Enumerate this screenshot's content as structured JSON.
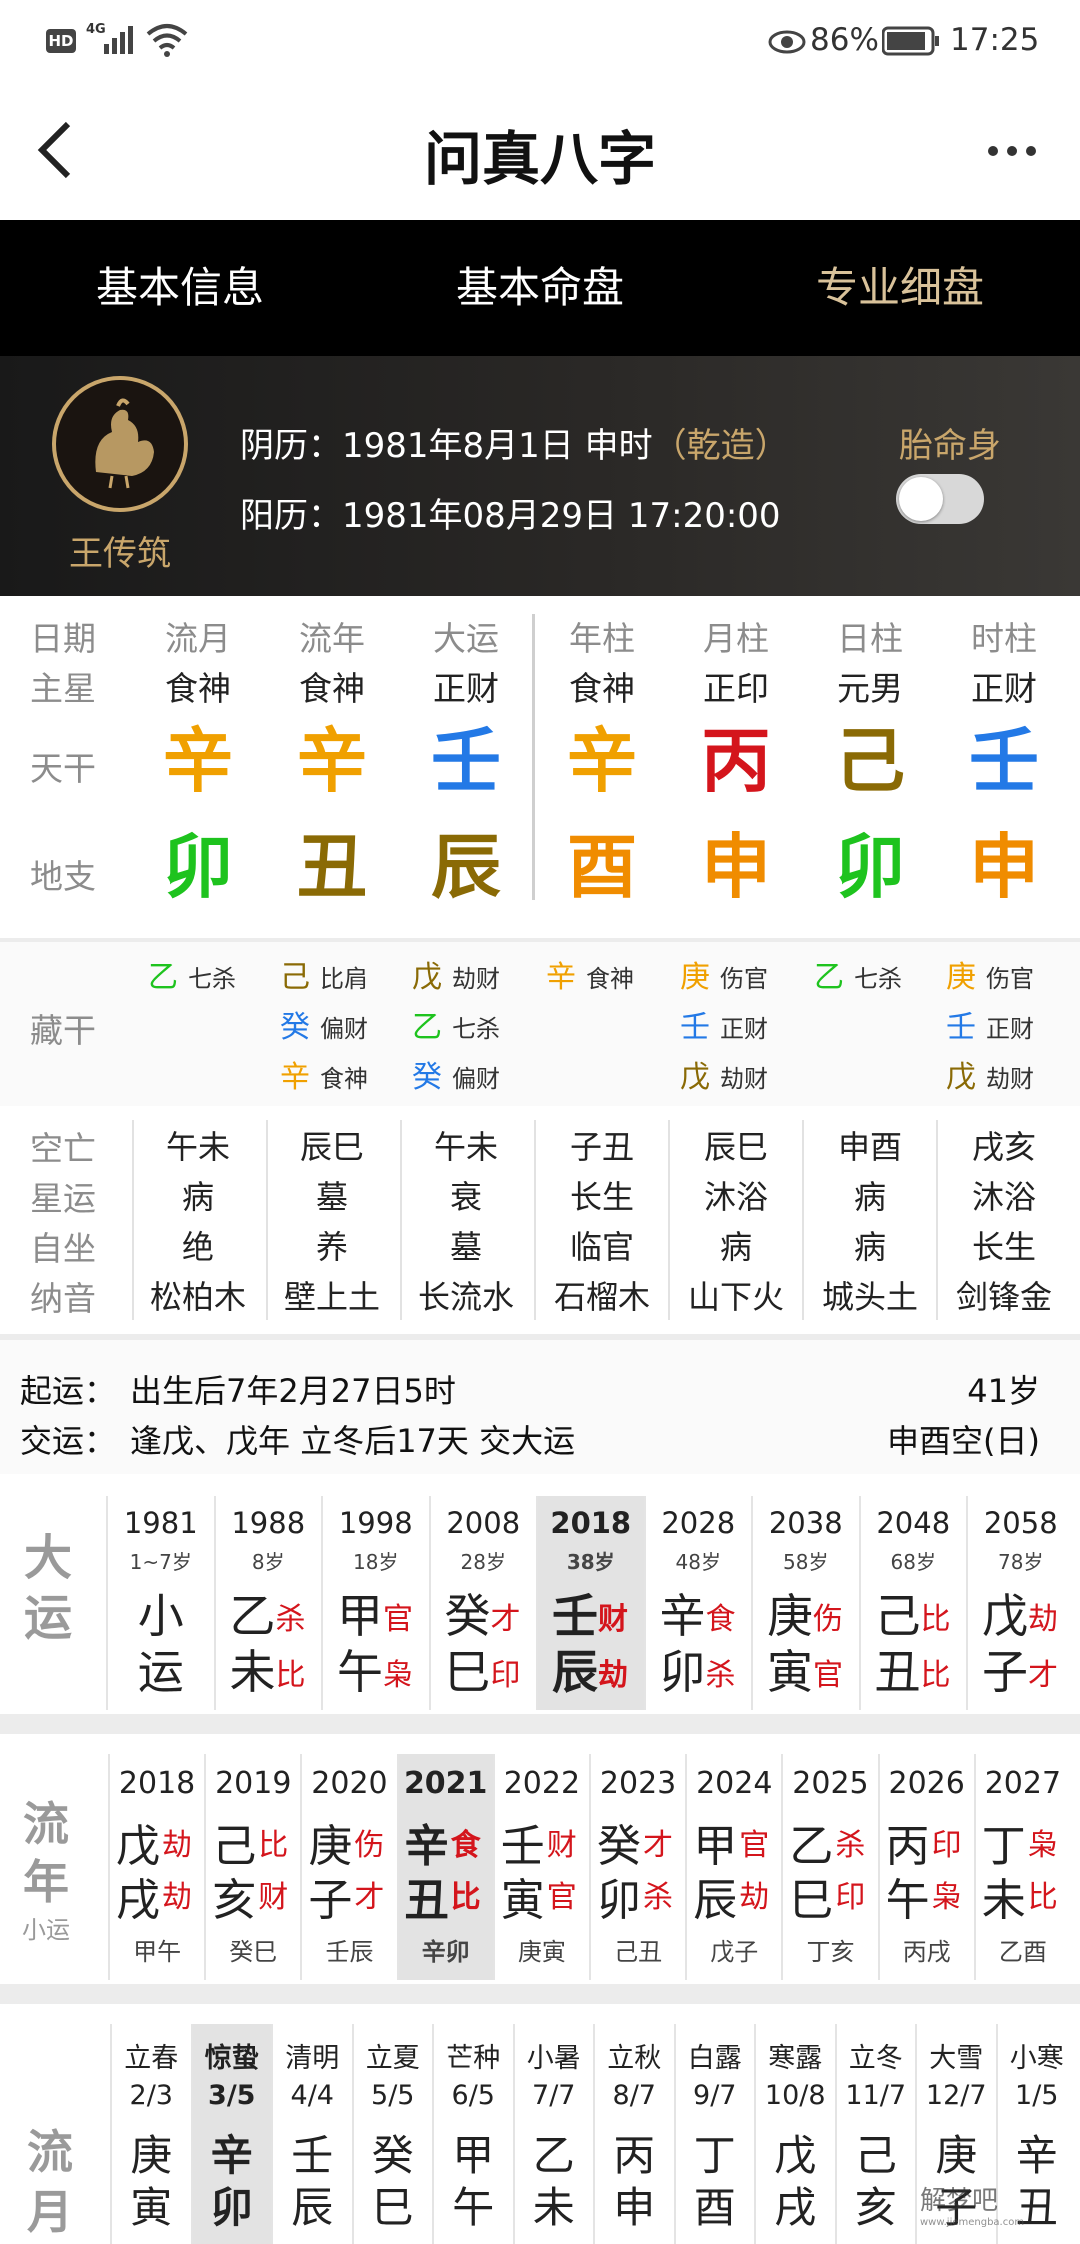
{
  "status": {
    "hd": "HD",
    "net": "4G",
    "battery": "86%",
    "time": "17:25"
  },
  "header": {
    "title": "问真八字",
    "back_icon": "chevron-left-icon",
    "more_icon": "more-dots-icon"
  },
  "tabs": [
    {
      "label": "基本信息"
    },
    {
      "label": "基本命盘"
    },
    {
      "label": "专业细盘"
    }
  ],
  "profile": {
    "name": "王传筑",
    "lunar_label": "阴历：",
    "lunar": "1981年8月1日 申时",
    "gender_tag": "（乾造）",
    "solar_label": "阳历：",
    "solar": "1981年08月29日 17:20:00",
    "toggle_label": "胎命身",
    "toggle_on": false
  },
  "chart": {
    "row_labels": [
      "日期",
      "主星",
      "天干",
      "地支"
    ],
    "columns": [
      {
        "head": "流月",
        "star": "食神",
        "stem": "辛",
        "branch": "卯"
      },
      {
        "head": "流年",
        "star": "食神",
        "stem": "辛",
        "branch": "丑"
      },
      {
        "head": "大运",
        "star": "正财",
        "stem": "壬",
        "branch": "辰"
      },
      {
        "head": "年柱",
        "star": "食神",
        "stem": "辛",
        "branch": "酉"
      },
      {
        "head": "月柱",
        "star": "正印",
        "stem": "丙",
        "branch": "申"
      },
      {
        "head": "日柱",
        "star": "元男",
        "stem": "己",
        "branch": "卯"
      },
      {
        "head": "时柱",
        "star": "正财",
        "stem": "壬",
        "branch": "申"
      }
    ],
    "colors": {
      "metal": "#f0a000",
      "water": "#2379e6",
      "fire": "#d4151c",
      "earth": "#8a6a05",
      "wood": "#1ec31e",
      "branch_metal": "#f08c00"
    }
  },
  "hidden": {
    "label": "藏干",
    "columns": [
      [
        {
          "c": "乙",
          "t": "七杀"
        }
      ],
      [
        {
          "c": "己",
          "t": "比肩"
        },
        {
          "c": "癸",
          "t": "偏财"
        },
        {
          "c": "辛",
          "t": "食神"
        }
      ],
      [
        {
          "c": "戊",
          "t": "劫财"
        },
        {
          "c": "乙",
          "t": "七杀"
        },
        {
          "c": "癸",
          "t": "偏财"
        }
      ],
      [
        {
          "c": "辛",
          "t": "食神"
        }
      ],
      [
        {
          "c": "庚",
          "t": "伤官"
        },
        {
          "c": "壬",
          "t": "正财"
        },
        {
          "c": "戊",
          "t": "劫财"
        }
      ],
      [
        {
          "c": "乙",
          "t": "七杀"
        }
      ],
      [
        {
          "c": "庚",
          "t": "伤官"
        },
        {
          "c": "壬",
          "t": "正财"
        },
        {
          "c": "戊",
          "t": "劫财"
        }
      ]
    ]
  },
  "attrs": {
    "labels": [
      "空亡",
      "星运",
      "自坐",
      "纳音"
    ],
    "columns": [
      [
        "午未",
        "病",
        "绝",
        "松柏木"
      ],
      [
        "辰巳",
        "墓",
        "养",
        "壁上土"
      ],
      [
        "午未",
        "衰",
        "墓",
        "长流水"
      ],
      [
        "子丑",
        "长生",
        "临官",
        "石榴木"
      ],
      [
        "辰巳",
        "沐浴",
        "病",
        "山下火"
      ],
      [
        "申酉",
        "病",
        "病",
        "城头土"
      ],
      [
        "戌亥",
        "沐浴",
        "长生",
        "剑锋金"
      ]
    ]
  },
  "luck_info": {
    "start_label": "起运：",
    "start": "出生后7年2月27日5时",
    "age": "41岁",
    "change_label": "交运：",
    "change": "逢戊、戊年 立冬后17天 交大运",
    "void": "申酉空(日)"
  },
  "dayun": {
    "label": "大运",
    "items": [
      {
        "year": "1981",
        "age": "1~7岁",
        "s": "小",
        "b": "运",
        "sg": "",
        "bg": "",
        "special": true
      },
      {
        "year": "1988",
        "age": "8岁",
        "s": "乙",
        "sg": "杀",
        "b": "未",
        "bg": "比"
      },
      {
        "year": "1998",
        "age": "18岁",
        "s": "甲",
        "sg": "官",
        "b": "午",
        "bg": "枭"
      },
      {
        "year": "2008",
        "age": "28岁",
        "s": "癸",
        "sg": "才",
        "b": "巳",
        "bg": "印"
      },
      {
        "year": "2018",
        "age": "38岁",
        "s": "壬",
        "sg": "财",
        "b": "辰",
        "bg": "劫",
        "sel": true
      },
      {
        "year": "2028",
        "age": "48岁",
        "s": "辛",
        "sg": "食",
        "b": "卯",
        "bg": "杀"
      },
      {
        "year": "2038",
        "age": "58岁",
        "s": "庚",
        "sg": "伤",
        "b": "寅",
        "bg": "官"
      },
      {
        "year": "2048",
        "age": "68岁",
        "s": "己",
        "sg": "比",
        "b": "丑",
        "bg": "比"
      },
      {
        "year": "2058",
        "age": "78岁",
        "s": "戊",
        "sg": "劫",
        "b": "子",
        "bg": "才"
      }
    ]
  },
  "liunian": {
    "label1": "流",
    "label2": "年",
    "label3": "小运",
    "items": [
      {
        "year": "2018",
        "s": "戊",
        "sg": "劫",
        "b": "戌",
        "bg": "劫",
        "xy": "甲午"
      },
      {
        "year": "2019",
        "s": "己",
        "sg": "比",
        "b": "亥",
        "bg": "财",
        "xy": "癸巳"
      },
      {
        "year": "2020",
        "s": "庚",
        "sg": "伤",
        "b": "子",
        "bg": "才",
        "xy": "壬辰"
      },
      {
        "year": "2021",
        "s": "辛",
        "sg": "食",
        "b": "丑",
        "bg": "比",
        "xy": "辛卯",
        "sel": true
      },
      {
        "year": "2022",
        "s": "壬",
        "sg": "财",
        "b": "寅",
        "bg": "官",
        "xy": "庚寅"
      },
      {
        "year": "2023",
        "s": "癸",
        "sg": "才",
        "b": "卯",
        "bg": "杀",
        "xy": "己丑"
      },
      {
        "year": "2024",
        "s": "甲",
        "sg": "官",
        "b": "辰",
        "bg": "劫",
        "xy": "戊子"
      },
      {
        "year": "2025",
        "s": "乙",
        "sg": "杀",
        "b": "巳",
        "bg": "印",
        "xy": "丁亥"
      },
      {
        "year": "2026",
        "s": "丙",
        "sg": "印",
        "b": "午",
        "bg": "枭",
        "xy": "丙戌"
      },
      {
        "year": "2027",
        "s": "丁",
        "sg": "枭",
        "b": "未",
        "bg": "比",
        "xy": "乙酉"
      }
    ]
  },
  "liuyue": {
    "label1": "流",
    "label2": "月",
    "items": [
      {
        "term": "立春",
        "date": "2/3",
        "s": "庚",
        "b": "寅"
      },
      {
        "term": "惊蛰",
        "date": "3/5",
        "s": "辛",
        "b": "卯",
        "sel": true
      },
      {
        "term": "清明",
        "date": "4/4",
        "s": "壬",
        "b": "辰"
      },
      {
        "term": "立夏",
        "date": "5/5",
        "s": "癸",
        "b": "巳"
      },
      {
        "term": "芒种",
        "date": "6/5",
        "s": "甲",
        "b": "午"
      },
      {
        "term": "小暑",
        "date": "7/7",
        "s": "乙",
        "b": "未"
      },
      {
        "term": "立秋",
        "date": "8/7",
        "s": "丙",
        "b": "申"
      },
      {
        "term": "白露",
        "date": "9/7",
        "s": "丁",
        "b": "酉"
      },
      {
        "term": "寒露",
        "date": "10/8",
        "s": "戊",
        "b": "戌"
      },
      {
        "term": "立冬",
        "date": "11/7",
        "s": "己",
        "b": "亥"
      },
      {
        "term": "大雪",
        "date": "12/7",
        "s": "庚",
        "b": "子"
      },
      {
        "term": "小寒",
        "date": "1/5",
        "s": "辛",
        "b": "丑"
      }
    ]
  },
  "watermark": {
    "text": "解梦吧",
    "url": "www.jiemengba.com"
  }
}
